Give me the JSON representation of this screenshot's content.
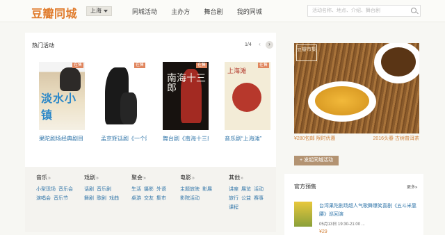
{
  "header": {
    "logo": "豆瓣同城",
    "city": "上海",
    "nav": [
      "同城活动",
      "主办方",
      "舞台剧",
      "我的同城"
    ],
    "search_placeholder": "活动名称、地点、介绍、舞台剧"
  },
  "hot": {
    "title": "热门活动",
    "pager": "1/4",
    "events": [
      {
        "badge": "在售",
        "poster_text": "淡水小镇",
        "title": "果陀剧场经典剧目《淡水小镇》..."
      },
      {
        "badge": "在售",
        "title": "孟京辉话剧《一个陌生女人的来..."
      },
      {
        "badge": "在售",
        "poster_text": "南海十三郎",
        "title": "舞台剧《南海十三郎》预售"
      },
      {
        "badge": "在售",
        "poster_text": "上海滩",
        "title": "音乐剧“上海滩”"
      }
    ]
  },
  "categories": [
    {
      "name": "音乐",
      "links": [
        [
          "小型现场",
          "音乐会"
        ],
        [
          "演唱会",
          "音乐节"
        ]
      ]
    },
    {
      "name": "戏剧",
      "links": [
        [
          "话剧",
          "音乐剧"
        ],
        [
          "舞剧",
          "歌剧",
          "戏曲"
        ]
      ]
    },
    {
      "name": "聚会",
      "links": [
        [
          "生活",
          "摄影",
          "外语"
        ],
        [
          "桌游",
          "交友",
          "集市"
        ]
      ]
    },
    {
      "name": "电影",
      "links": [
        [
          "主题放映",
          "影展"
        ],
        [
          "影院活动"
        ]
      ]
    },
    {
      "name": "其他",
      "links": [
        [
          "讲座",
          "展览",
          "活动"
        ],
        [
          "旅行",
          "公益",
          "赛事"
        ],
        [
          "课程"
        ]
      ]
    }
  ],
  "promo": {
    "seal": "豆瓣市集",
    "price_text": "¥280包邮  限时优惠",
    "right_text": "2016头春 古树普洱茶"
  },
  "post_button": "+ 发起同城活动",
  "preview": {
    "title": "官方预售",
    "more": "更多»",
    "item_title": "台湾果陀剧场超人气歌舞爆笑喜剧《五斗米靠腰》巡回演",
    "date": "05月13日 19:30-21:00 ...",
    "price": "¥29"
  }
}
